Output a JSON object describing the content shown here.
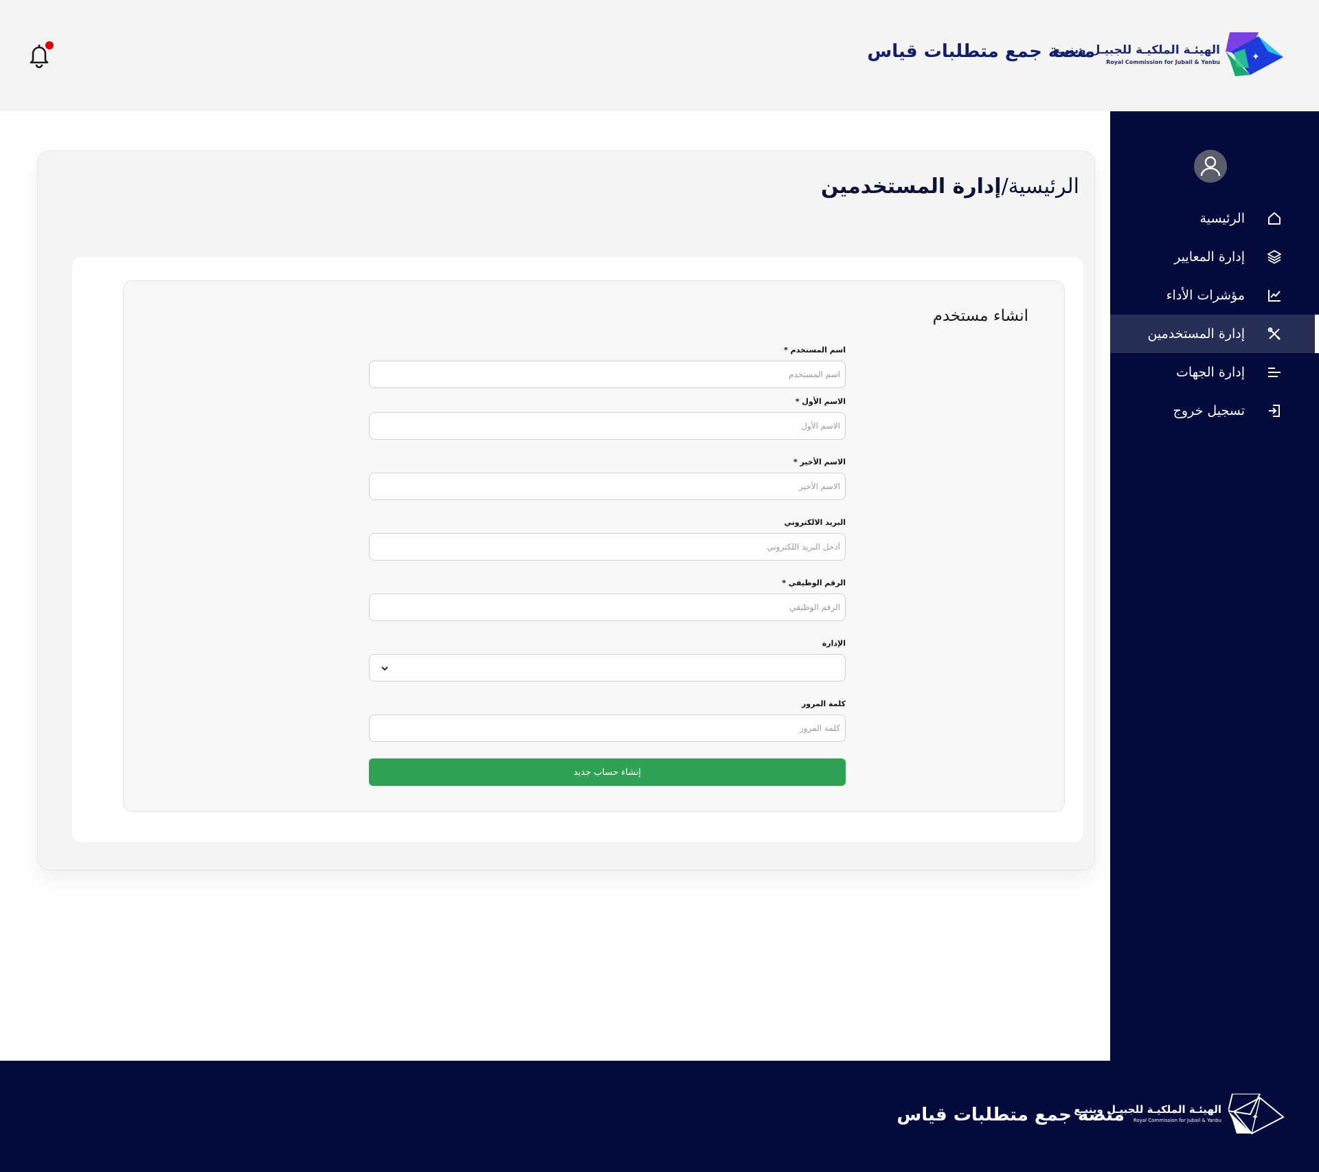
{
  "header": {
    "platform_title": "منصة جمع متطلبات قياس",
    "logo_ar": "الهيئـة الملكيـة للجبيـل وينبـع",
    "logo_en": "Royal Commission for Jubail & Yanbu",
    "notification_icon": "bell-icon"
  },
  "sidebar": {
    "avatar_icon": "user-avatar-icon",
    "items": [
      {
        "label": "الرئيسية",
        "icon": "home-icon",
        "active": false
      },
      {
        "label": "إدارة المعايير",
        "icon": "layers-icon",
        "active": false
      },
      {
        "label": "مؤشرات الأداء",
        "icon": "line-chart-icon",
        "active": false
      },
      {
        "label": "إدارة المستخدمين",
        "icon": "tools-icon",
        "active": true
      },
      {
        "label": "إدارة الجهات",
        "icon": "align-lines-icon",
        "active": false
      },
      {
        "label": "تسجيل خروج",
        "icon": "logout-icon",
        "active": false
      }
    ]
  },
  "breadcrumb": {
    "home": "الرئيسية/",
    "current": "إدارة المستخدمين"
  },
  "form": {
    "title": "انشاء مستخدم",
    "fields": {
      "username": {
        "label": "اسم المستخدم *",
        "placeholder": "اسم المستخدم",
        "value": ""
      },
      "first_name": {
        "label": "الاسم الأول *",
        "placeholder": "الاسم الأول",
        "value": ""
      },
      "last_name": {
        "label": "الاسم الأخير *",
        "placeholder": "الاسم الأخير",
        "value": ""
      },
      "email": {
        "label": "البريد الالكتروني",
        "placeholder": "أدخل البريد اللكتروني",
        "value": ""
      },
      "employee_id": {
        "label": "الرقم الوظيفي *",
        "placeholder": "الرقم الوظيفي",
        "value": ""
      },
      "department": {
        "label": "الإدارة",
        "selected": ""
      },
      "password": {
        "label": "كلمة المرور",
        "placeholder": "كلمة المرور",
        "value": ""
      }
    },
    "submit_label": "إنشاء حساب جديد",
    "submit_color": "#2fa152"
  },
  "footer": {
    "platform_title": "منصة جمع متطلبات قياس",
    "logo_ar": "الهيئـة الملكيـة للجبيـل وينبـع",
    "logo_en": "Royal Commission for Jubail & Yanbu"
  },
  "colors": {
    "navy": "#020b3b",
    "active_nav": "#262f57",
    "header_bg": "#f4f4f4",
    "notification_dot": "#d60000"
  }
}
